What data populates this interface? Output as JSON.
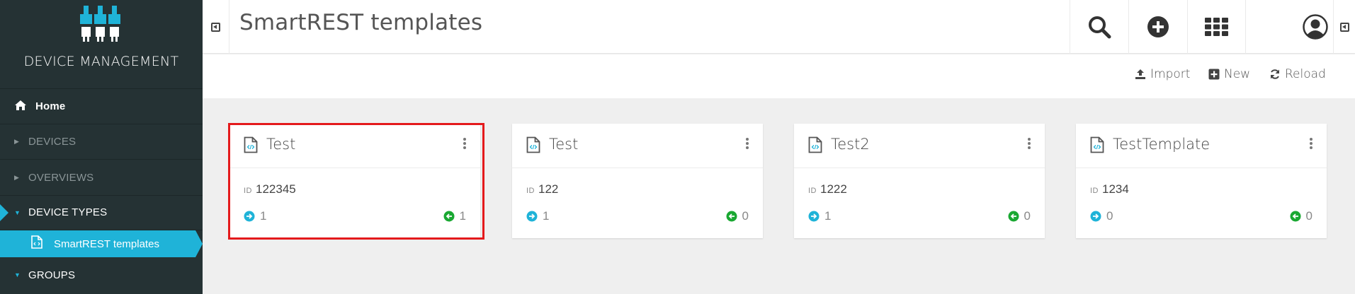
{
  "sidebar": {
    "brand": "DEVICE MANAGEMENT",
    "items": [
      {
        "label": "Home",
        "icon": "home-icon"
      },
      {
        "label": "DEVICES",
        "icon": "caret-right-icon"
      },
      {
        "label": "OVERVIEWS",
        "icon": "caret-right-icon"
      },
      {
        "label": "DEVICE TYPES",
        "icon": "caret-down-icon"
      },
      {
        "label": "SmartREST templates",
        "icon": "code-file-icon"
      },
      {
        "label": "GROUPS",
        "icon": "caret-down-icon"
      }
    ]
  },
  "header": {
    "title": "SmartREST templates"
  },
  "actions": {
    "import": "Import",
    "new": "New",
    "reload": "Reload"
  },
  "cards": [
    {
      "title": "Test",
      "id_label": "ID",
      "id": "122345",
      "inbound": "1",
      "outbound": "1",
      "selected": true
    },
    {
      "title": "Test",
      "id_label": "ID",
      "id": "122",
      "inbound": "1",
      "outbound": "0",
      "selected": false
    },
    {
      "title": "Test2",
      "id_label": "ID",
      "id": "1222",
      "inbound": "1",
      "outbound": "0",
      "selected": false
    },
    {
      "title": "TestTemplate",
      "id_label": "ID",
      "id": "1234",
      "inbound": "0",
      "outbound": "0",
      "selected": false
    }
  ],
  "colors": {
    "sidebar_bg": "#253234",
    "accent": "#1fb3d8",
    "inbound": "#1fb3d8",
    "outbound": "#1aa832",
    "highlight": "#e41a1c"
  }
}
